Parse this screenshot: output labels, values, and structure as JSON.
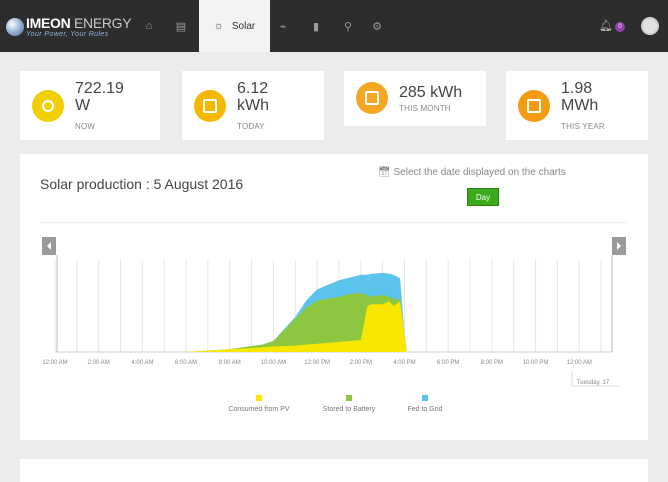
{
  "app": {
    "name_bold": "IMEON",
    "name_light": " ENERGY",
    "tagline": "Your Power, Your Rules"
  },
  "nav": {
    "items": [
      {
        "icon": "home-icon",
        "glyph": "⌂"
      },
      {
        "icon": "dashboard-chart-icon",
        "glyph": "▤"
      },
      {
        "icon": "solar-sun-icon",
        "glyph": "☼",
        "label": "Solar",
        "active": true
      },
      {
        "icon": "plug-icon",
        "glyph": "⌁"
      },
      {
        "icon": "battery-icon",
        "glyph": "▮"
      },
      {
        "icon": "location-pin-icon",
        "glyph": "⚲"
      },
      {
        "icon": "settings-gears-icon",
        "glyph": "⚙"
      }
    ],
    "notifications_count": "0"
  },
  "stats": [
    {
      "value": "722.19",
      "unit": "W",
      "label": "NOW",
      "color": "#f2cf00",
      "icon": "gauge-icon"
    },
    {
      "value": "6.12",
      "unit": "kWh",
      "label": "TODAY",
      "color": "#f5b800",
      "icon": "calendar-day-icon"
    },
    {
      "value": "285 kWh",
      "unit": "",
      "label": "THIS MONTH",
      "color": "#f5a623",
      "icon": "calendar-month-icon"
    },
    {
      "value": "1.98",
      "unit": "MWh",
      "label": "THIS YEAR",
      "color": "#f39c12",
      "icon": "calendar-year-icon"
    }
  ],
  "panel": {
    "title": "Solar production : 5 August 2016",
    "date_select_label": "Select the date displayed on the charts",
    "day_button": "Day"
  },
  "chart_data": {
    "type": "area",
    "x_tick_labels": [
      "12:00 AM",
      "2:00 AM",
      "4:00 AM",
      "6:00 AM",
      "8:00 AM",
      "10:00 AM",
      "12:00 PM",
      "2:00 PM",
      "4:00 PM",
      "6:00 PM",
      "8:00 PM",
      "10:00 PM",
      "12:00 AM"
    ],
    "x_secondary_label": "Tuesday, 17",
    "x_range_hours": [
      0,
      25.5
    ],
    "y_range": [
      0,
      1
    ],
    "grid": true,
    "legend_placement": "bottom",
    "x_hours": [
      6.0,
      8.0,
      9.5,
      10.0,
      11.0,
      11.5,
      12.0,
      13.0,
      13.5,
      14.0,
      14.3,
      14.5,
      15.0,
      15.3,
      15.5,
      15.8,
      16.0,
      16.1
    ],
    "series": [
      {
        "name": "Consumed from PV",
        "color": "#f7e600",
        "values": [
          0.0,
          0.03,
          0.05,
          0.06,
          0.07,
          0.08,
          0.09,
          0.11,
          0.12,
          0.13,
          0.5,
          0.52,
          0.52,
          0.55,
          0.5,
          0.55,
          0.2,
          0.0
        ]
      },
      {
        "name": "Stored to Battery",
        "color": "#8dc63f",
        "values": [
          0.0,
          0.03,
          0.08,
          0.12,
          0.36,
          0.48,
          0.56,
          0.6,
          0.63,
          0.64,
          0.62,
          0.6,
          0.62,
          0.6,
          0.58,
          0.57,
          0.2,
          0.0
        ]
      },
      {
        "name": "Fed to Grid",
        "color": "#5bc4ec",
        "values": [
          0.0,
          0.03,
          0.08,
          0.12,
          0.38,
          0.56,
          0.68,
          0.78,
          0.81,
          0.84,
          0.84,
          0.85,
          0.86,
          0.85,
          0.84,
          0.8,
          0.2,
          0.0
        ]
      }
    ]
  }
}
